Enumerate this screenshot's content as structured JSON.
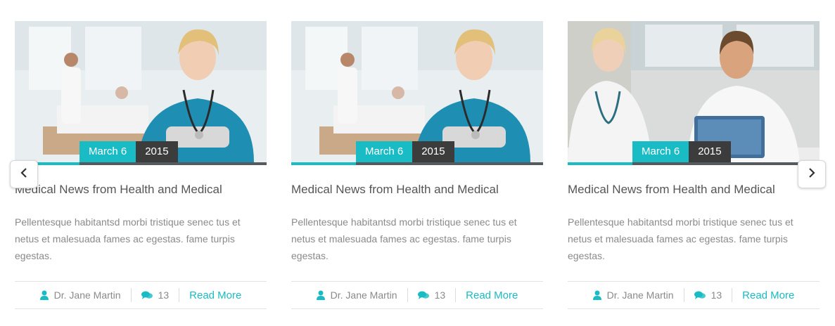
{
  "accent_color": "#19bcc4",
  "nav": {
    "prev_icon": "chevron-left-icon",
    "next_icon": "chevron-right-icon"
  },
  "cards": [
    {
      "image": "nurse-smiling-in-hospital-ward",
      "date_day": "March 6",
      "date_year": "2015",
      "title": "Medical News from Health and Medical",
      "excerpt": "Pellentesque habitantsd morbi tristique senec tus et netus et malesuada fames ac egestas. fame turpis egestas.",
      "author": "Dr. Jane Martin",
      "comments": "13",
      "read_more": "Read More"
    },
    {
      "image": "nurse-smiling-in-hospital-ward",
      "date_day": "March 6",
      "date_year": "2015",
      "title": "Medical News from Health and Medical",
      "excerpt": "Pellentesque habitantsd morbi tristique senec tus et netus et malesuada fames ac egestas. fame turpis egestas.",
      "author": "Dr. Jane Martin",
      "comments": "13",
      "read_more": "Read More"
    },
    {
      "image": "doctor-consulting-patient",
      "date_day": "March 6",
      "date_year": "2015",
      "title": "Medical News from Health and Medical",
      "excerpt": "Pellentesque habitantsd morbi tristique senec tus et netus et malesuada fames ac egestas. fame turpis egestas.",
      "author": "Dr. Jane Martin",
      "comments": "13",
      "read_more": "Read More"
    }
  ]
}
